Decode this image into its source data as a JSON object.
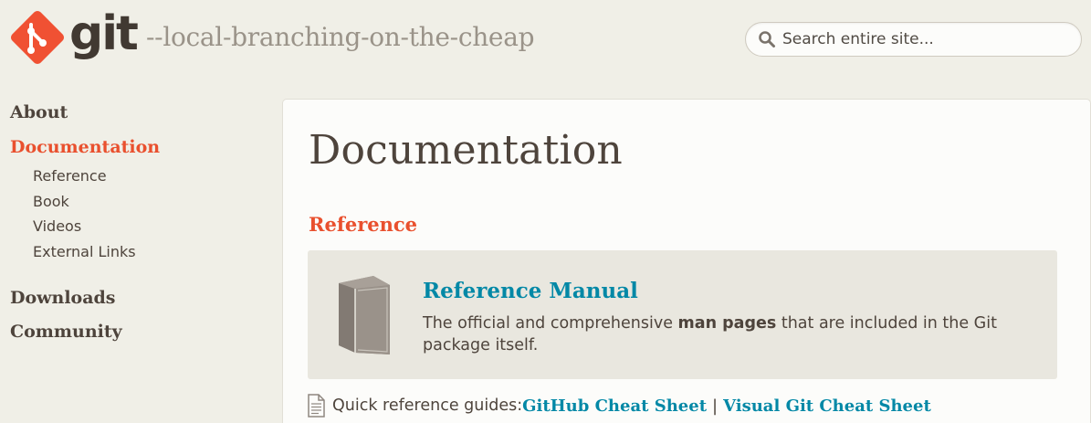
{
  "header": {
    "logo_text": "git",
    "tagline": "--local-branching-on-the-cheap",
    "search_placeholder": "Search entire site..."
  },
  "sidebar": {
    "about": "About",
    "documentation": "Documentation",
    "subitems": [
      "Reference",
      "Book",
      "Videos",
      "External Links"
    ],
    "downloads": "Downloads",
    "community": "Community"
  },
  "main": {
    "title": "Documentation",
    "section_title": "Reference",
    "callout": {
      "title": "Reference Manual",
      "desc_before": "The official and comprehensive ",
      "desc_bold": "man pages",
      "desc_after": " that are included in the Git package itself."
    },
    "quickref": {
      "label": "Quick reference guides: ",
      "link1": "GitHub Cheat Sheet",
      "separator": "|",
      "link2": "Visual Git Cheat Sheet"
    }
  },
  "colors": {
    "brand": "#f05133",
    "accent_link": "#0388a6",
    "background": "#f0efe7"
  },
  "icons": {
    "logo": "git-logo-icon",
    "search": "search-icon",
    "book": "book-icon",
    "document": "document-icon"
  }
}
